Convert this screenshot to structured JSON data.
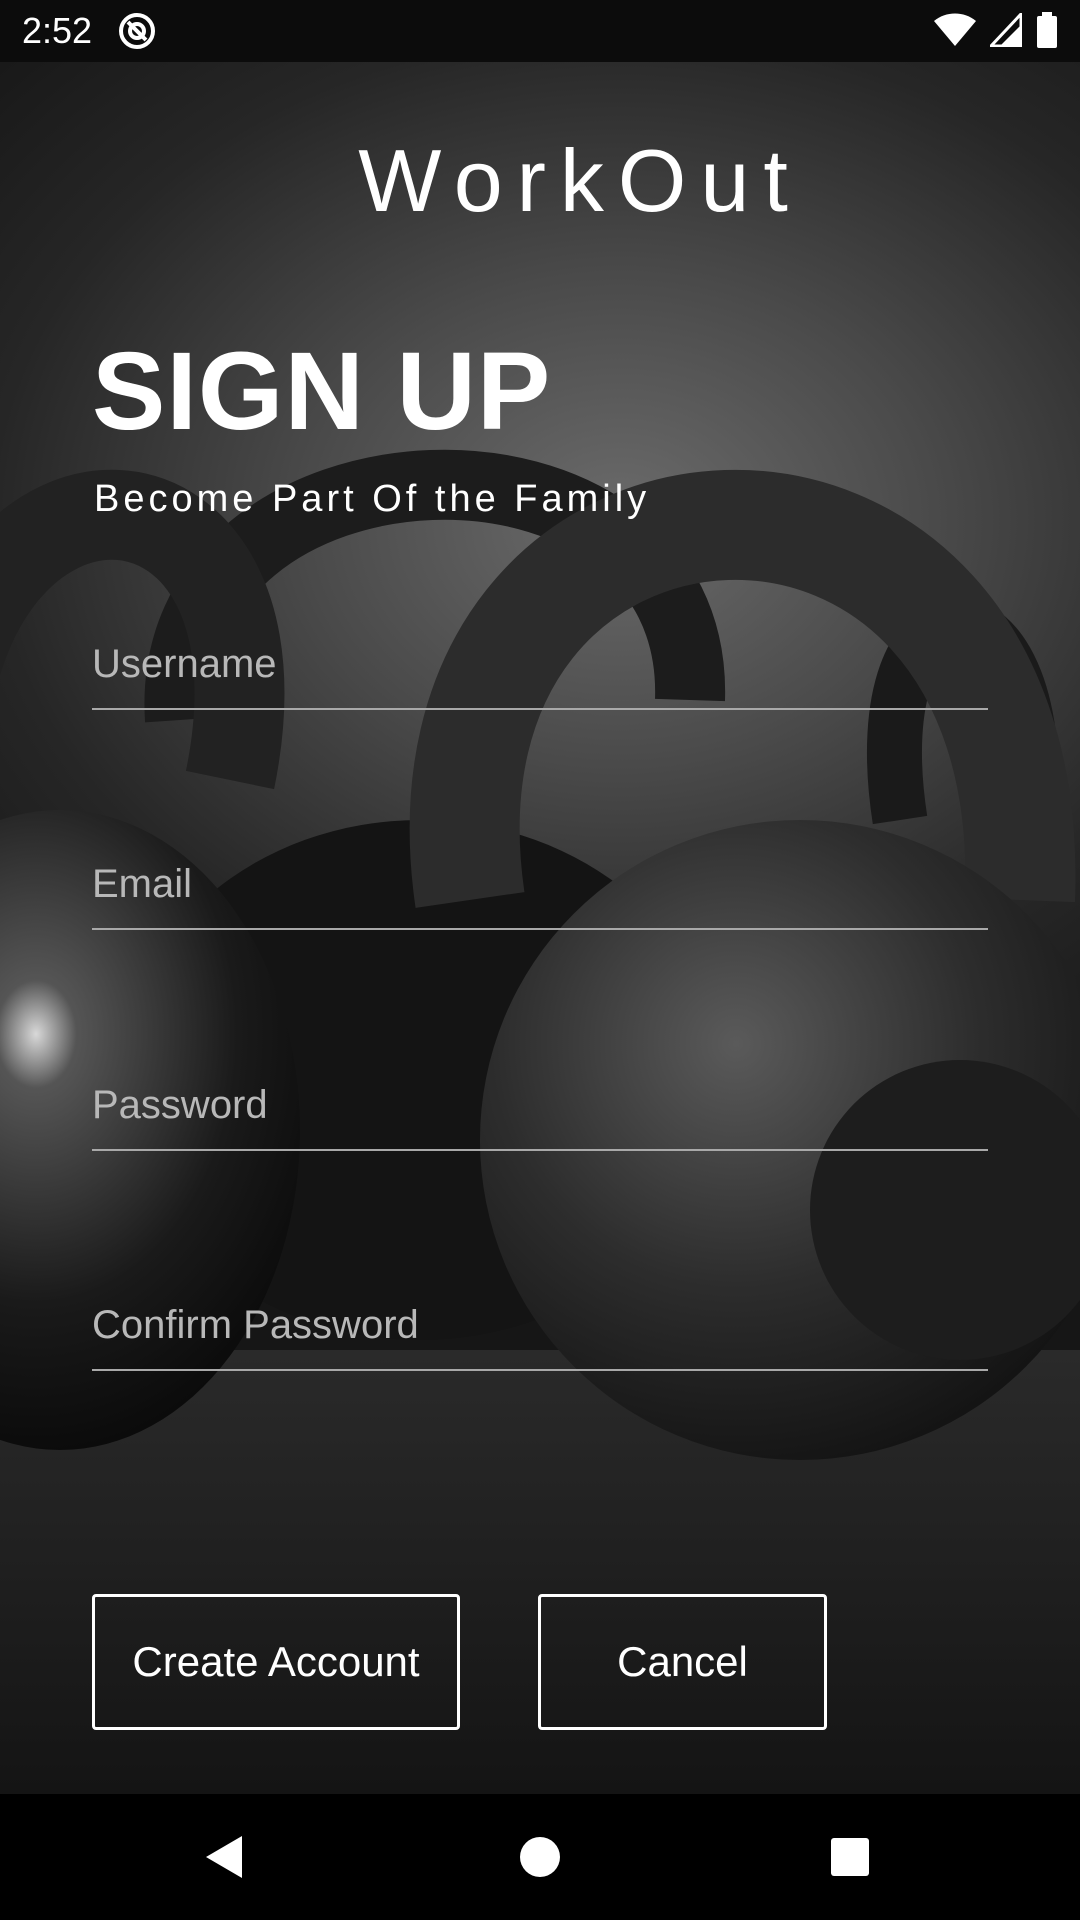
{
  "status_bar": {
    "time": "2:52",
    "app_icon": "at-sign-icon",
    "icons": [
      "wifi-icon",
      "signal-icon",
      "battery-icon"
    ]
  },
  "app": {
    "title": "WorkOut"
  },
  "form": {
    "heading": "SIGN UP",
    "subheading": "Become Part Of the Family",
    "username_placeholder": "Username",
    "email_placeholder": "Email",
    "password_placeholder": "Password",
    "confirm_password_placeholder": "Confirm Password",
    "create_account_label": "Create Account",
    "cancel_label": "Cancel"
  },
  "nav": {
    "back": "back-icon",
    "home": "home-icon",
    "recents": "recents-icon"
  },
  "colors": {
    "text": "#ffffff",
    "underline": "#a9a9a9",
    "placeholder": "#b8b8b8",
    "nav_background": "#000000"
  }
}
